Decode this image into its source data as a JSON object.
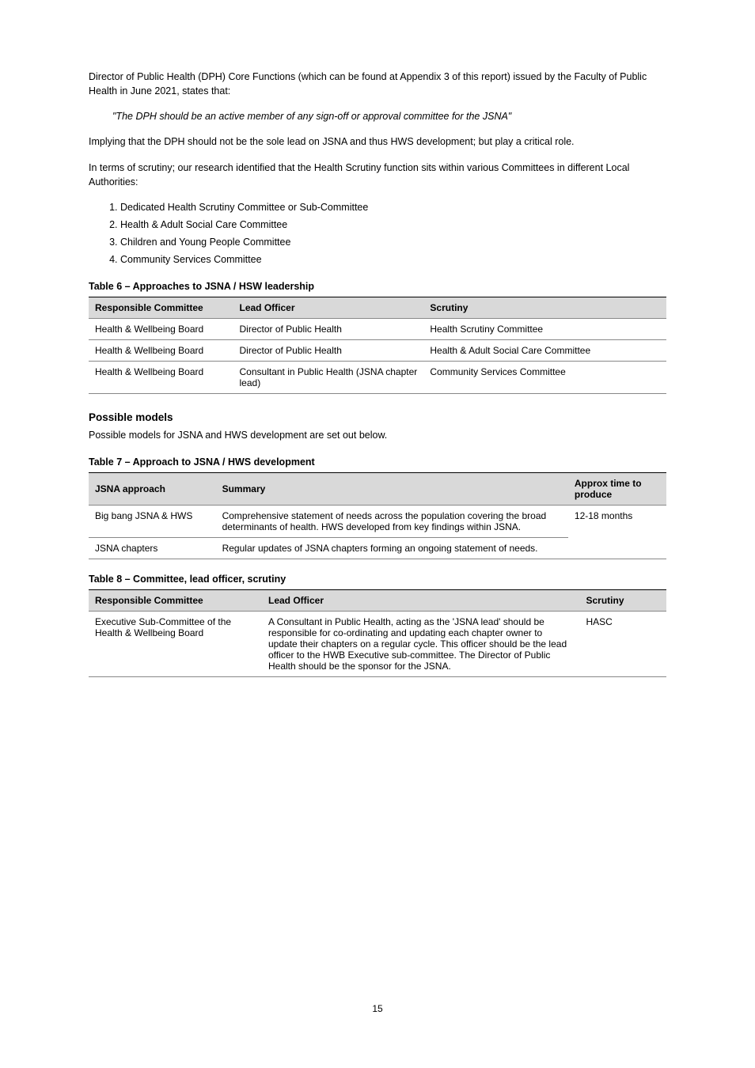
{
  "para1": "Director of Public Health (DPH) Core Functions (which can be found at Appendix 3 of this report) issued by the Faculty of Public Health in June 2021, states that:",
  "quote": "\"The DPH should be an active member of any sign-off or approval committee for the JSNA\"",
  "para2": "Implying that the DPH should not be the sole lead on JSNA and thus HWS development; but play a critical role.",
  "para3": "In terms of scrutiny; our research identified that the Health Scrutiny function sits within various Committees in different Local Authorities:",
  "list": [
    "Dedicated Health Scrutiny Committee or Sub-Committee",
    "Health & Adult Social Care Committee",
    "Children and Young People Committee",
    "Community Services Committee"
  ],
  "table6_title": "Table 6 – Approaches to JSNA / HSW leadership",
  "table6_headers": [
    "Responsible Committee",
    "Lead Officer",
    "Scrutiny"
  ],
  "table6_rows": [
    [
      "Health & Wellbeing Board",
      "Director of Public Health",
      "Health Scrutiny Committee"
    ],
    [
      "Health & Wellbeing Board",
      "Director of Public Health",
      "Health & Adult Social Care Committee"
    ],
    [
      "Health & Wellbeing Board",
      "Consultant in Public Health (JSNA chapter lead)",
      "Community Services Committee"
    ]
  ],
  "section_title": "Possible models",
  "section_intro": "Possible models for JSNA and HWS development are set out below.",
  "table7_title": "Table 7 – Approach to JSNA / HWS development",
  "table7_headers": [
    "JSNA approach",
    "Summary",
    "Approx time to produce"
  ],
  "table7_rows": [
    [
      "Big bang JSNA & HWS",
      "Comprehensive statement of needs across the population covering the broad determinants of health. HWS developed from key findings within JSNA.",
      "12-18 months"
    ],
    [
      "JSNA chapters",
      "Regular updates of JSNA chapters forming an ongoing statement of needs.",
      ""
    ]
  ],
  "table8_title": "Table 8 – Committee, lead officer, scrutiny",
  "table8_headers": [
    "Responsible Committee",
    "Lead Officer",
    "Scrutiny"
  ],
  "table8_rows": [
    [
      "Executive Sub-Committee of the Health & Wellbeing Board",
      "A Consultant in Public Health, acting as the 'JSNA lead' should be responsible for co-ordinating and updating each chapter owner to update their chapters on a regular cycle. This officer should be the lead officer to the HWB Executive sub-committee. The Director of Public Health should be the sponsor for the JSNA.",
      "HASC"
    ]
  ],
  "page_number": "15"
}
